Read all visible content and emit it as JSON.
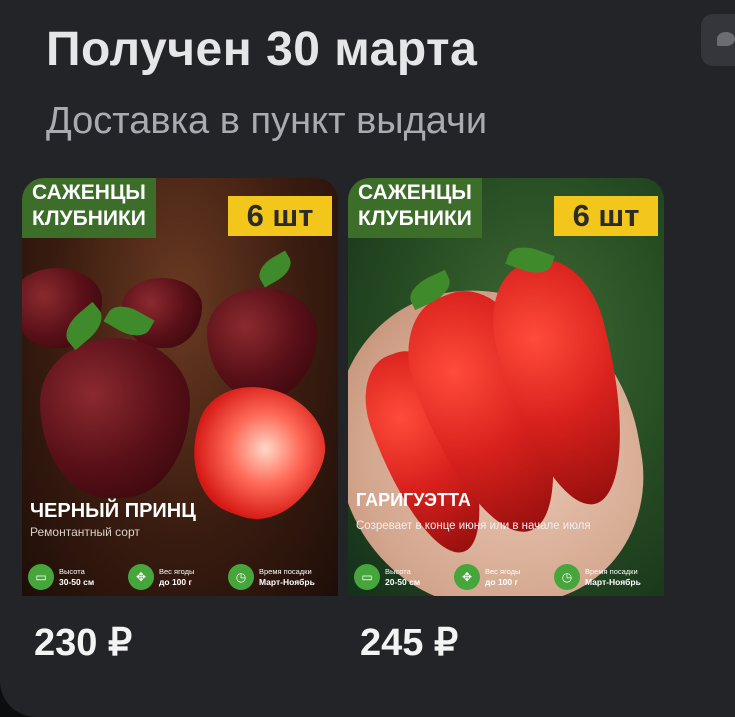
{
  "header": {
    "title": "Получен 30 марта",
    "subtitle": "Доставка в пункт выдачи"
  },
  "products": [
    {
      "banner_line1": "САЖЕНЦЫ",
      "banner_line2": "КЛУБНИКИ",
      "badge": "6 шт",
      "name": "ЧЕРНЫЙ ПРИНЦ",
      "description": "Ремонтантный сорт",
      "specs": [
        {
          "icon": "ruler-icon",
          "label": "Высота",
          "value": "30-50 см"
        },
        {
          "icon": "target-icon",
          "label": "Вес ягоды",
          "value": "до 100 г"
        },
        {
          "icon": "calendar-icon",
          "label": "Время посадки",
          "value": "Март-Ноябрь"
        }
      ],
      "price": "230 ₽"
    },
    {
      "banner_line1": "САЖЕНЦЫ",
      "banner_line2": "КЛУБНИКИ",
      "badge": "6 шт",
      "name": "ГАРИГУЭТТА",
      "description": "Созревает в конце июня или в начале июля",
      "specs": [
        {
          "icon": "ruler-icon",
          "label": "Высота",
          "value": "20-50 см"
        },
        {
          "icon": "target-icon",
          "label": "Вес ягоды",
          "value": "до 100 г"
        },
        {
          "icon": "calendar-icon",
          "label": "Время посадки",
          "value": "Март-Ноябрь"
        }
      ],
      "price": "245 ₽"
    }
  ],
  "colors": {
    "background": "#232428",
    "banner": "#3c6e2a",
    "badge": "#f3c61b",
    "spec_icon": "#47a63b"
  }
}
